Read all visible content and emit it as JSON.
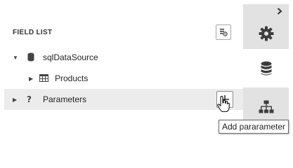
{
  "field_list": {
    "title": "FIELD LIST",
    "options_icon": "field-list-options-icon",
    "tree": [
      {
        "label": "sqlDataSource",
        "expander": "▼",
        "icon": "database-icon"
      },
      {
        "label": "Products",
        "expander": "▶",
        "icon": "table-icon"
      },
      {
        "label": "Parameters",
        "expander": "▶",
        "icon": "question-icon",
        "action_icon": "plus-icon"
      }
    ]
  },
  "tabs": [
    {
      "name": "properties",
      "icon": "gear-icon"
    },
    {
      "name": "field-list",
      "icon": "database-icon",
      "active": true
    },
    {
      "name": "report-explorer",
      "icon": "hierarchy-icon"
    }
  ],
  "collapse_icon": "chevron-right-icon",
  "tooltip": {
    "text": "Add pararameter"
  },
  "colors": {
    "panel": "#ffffff",
    "tab_bar": "#e2e2e2",
    "selected_row": "#ececec",
    "icon": "#444444"
  }
}
